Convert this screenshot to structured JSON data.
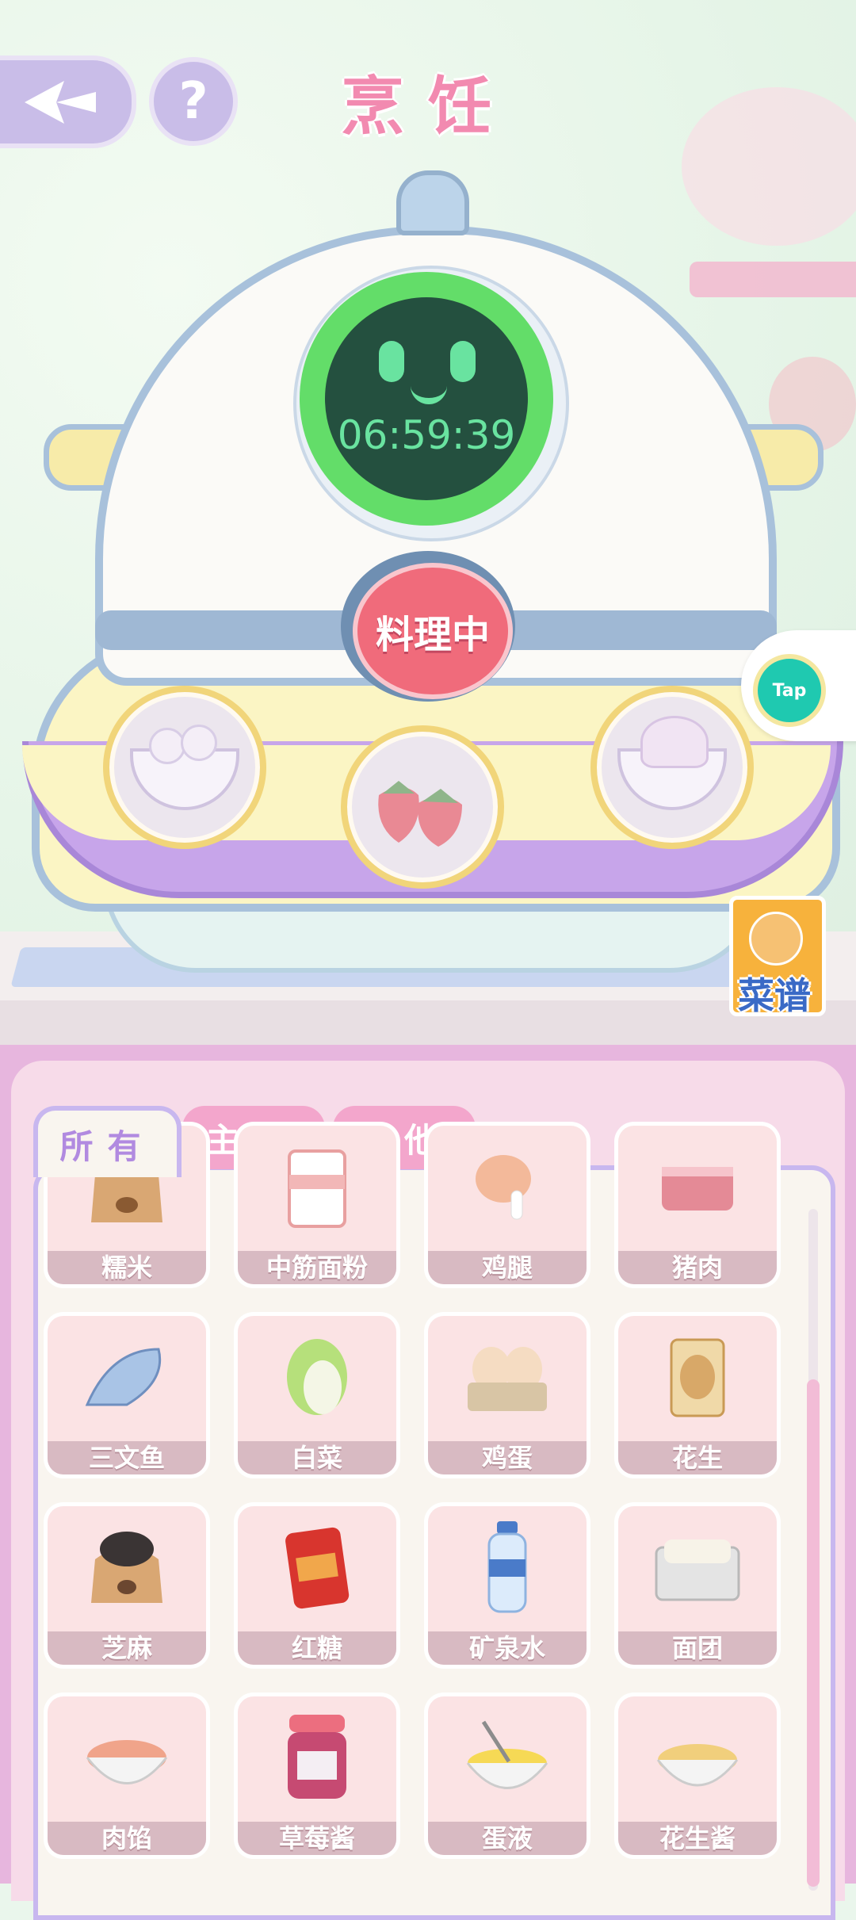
{
  "header": {
    "title": "烹饪"
  },
  "cooker": {
    "timer": "06:59:39",
    "status_button": "料理中"
  },
  "slots": [
    {
      "icon": "rice-ball-bowl-icon"
    },
    {
      "icon": "strawberry-icon"
    },
    {
      "icon": "cream-bowl-icon"
    }
  ],
  "side": {
    "tap_label": "Tap",
    "recipe_label": "菜谱"
  },
  "tabs": [
    {
      "label": "所有",
      "active": true
    },
    {
      "label": "主食",
      "active": false
    },
    {
      "label": "其他",
      "active": false
    }
  ],
  "ingredients": [
    {
      "label": "糯米",
      "icon": "rice-sack-icon"
    },
    {
      "label": "中筋面粉",
      "icon": "flour-bag-icon"
    },
    {
      "label": "鸡腿",
      "icon": "chicken-leg-icon"
    },
    {
      "label": "猪肉",
      "icon": "pork-icon"
    },
    {
      "label": "三文鱼",
      "icon": "salmon-icon"
    },
    {
      "label": "白菜",
      "icon": "cabbage-icon"
    },
    {
      "label": "鸡蛋",
      "icon": "eggs-icon"
    },
    {
      "label": "花生",
      "icon": "peanut-bag-icon"
    },
    {
      "label": "芝麻",
      "icon": "sesame-sack-icon"
    },
    {
      "label": "红糖",
      "icon": "brown-sugar-icon"
    },
    {
      "label": "矿泉水",
      "icon": "water-bottle-icon"
    },
    {
      "label": "面团",
      "icon": "dough-box-icon"
    },
    {
      "label": "肉馅",
      "icon": "meat-filling-icon"
    },
    {
      "label": "草莓酱",
      "icon": "strawberry-jam-icon"
    },
    {
      "label": "蛋液",
      "icon": "egg-liquid-icon"
    },
    {
      "label": "花生酱",
      "icon": "peanut-butter-icon"
    }
  ]
}
